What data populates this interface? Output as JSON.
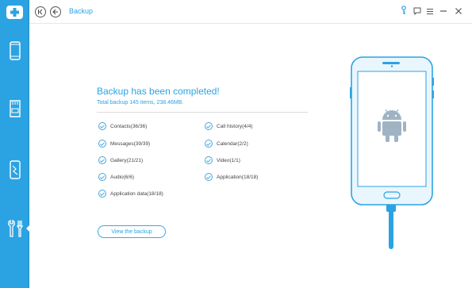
{
  "header": {
    "title": "Backup"
  },
  "colors": {
    "accent": "#2ba3e3",
    "sidebar_bg": "#2ba3e3"
  },
  "sidebar": {
    "items": [
      {
        "icon": "phone-icon"
      },
      {
        "icon": "sd-card-icon"
      },
      {
        "icon": "broken-phone-icon"
      },
      {
        "icon": "tools-icon",
        "active": true
      }
    ]
  },
  "toolbar": {
    "icons": [
      "key-icon",
      "feedback-icon",
      "menu-icon",
      "minimize-icon",
      "close-icon"
    ]
  },
  "main": {
    "title": "Backup has been completed!",
    "subtitle": "Total backup 145 items, 238.46MB.",
    "items_left": [
      "Contacts(36/36)",
      "Messages(39/39)",
      "Gallery(21/21)",
      "Audio(6/6)",
      "Application data(18/18)"
    ],
    "items_right": [
      "Call history(4/4)",
      "Calendar(2/2)",
      "Video(1/1)",
      "Application(18/18)"
    ],
    "view_button": "View the backup"
  }
}
